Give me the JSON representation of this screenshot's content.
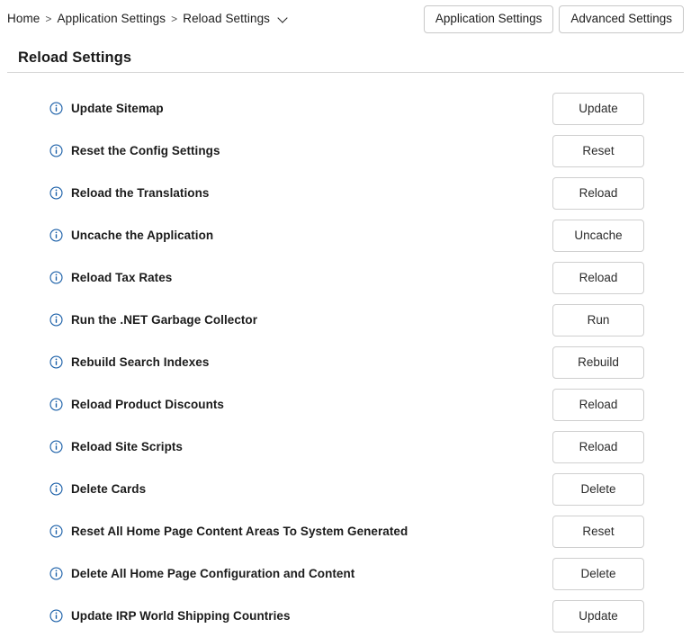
{
  "breadcrumb": {
    "items": [
      {
        "label": "Home"
      },
      {
        "label": "Application Settings"
      },
      {
        "label": "Reload Settings"
      }
    ],
    "separator": ">",
    "caret_icon": "chevron-down-icon"
  },
  "header": {
    "buttons": [
      {
        "label": "Application Settings"
      },
      {
        "label": "Advanced Settings"
      }
    ]
  },
  "page": {
    "title": "Reload Settings"
  },
  "colors": {
    "info_icon": "#1a5fa8",
    "rule": "#d6d6d6",
    "button_border": "#cfcfcf",
    "text": "#1b1b1b"
  },
  "list": {
    "info_icon_name": "info-icon",
    "rows": [
      {
        "label": "Update Sitemap",
        "label_bold_part": "",
        "action": "Update"
      },
      {
        "label": "Reset the Config Settings",
        "label_bold_part": "",
        "action": "Reset"
      },
      {
        "label": "Reload the Translations",
        "label_bold_part": "",
        "action": "Reload"
      },
      {
        "label": "Uncache the Application",
        "label_bold_part": "",
        "action": "Uncache"
      },
      {
        "label": "Reload Tax Rates",
        "label_bold_part": "",
        "action": "Reload"
      },
      {
        "label": "Run the .NET Garbage Collector",
        "label_bold_part": "",
        "action": "Run"
      },
      {
        "label": "Rebuild Search Indexes",
        "label_bold_part": "",
        "action": "Rebuild"
      },
      {
        "label": "Reload Product Discounts",
        "label_bold_part": "",
        "action": "Reload"
      },
      {
        "label": "Reload Site Scripts",
        "label_bold_part": "",
        "action": "Reload"
      },
      {
        "label": "Delete Cards",
        "label_bold_part": "",
        "action": "Delete"
      },
      {
        "label": "Reset All Home Page Content Areas To System Generated",
        "label_bold_part": "",
        "action": "Reset"
      },
      {
        "label": "Delete All Home Page Configuration and Content",
        "label_bold_part": "and",
        "action": "Delete"
      },
      {
        "label": "Update IRP World Shipping Countries",
        "label_bold_part": "",
        "action": "Update"
      }
    ]
  }
}
